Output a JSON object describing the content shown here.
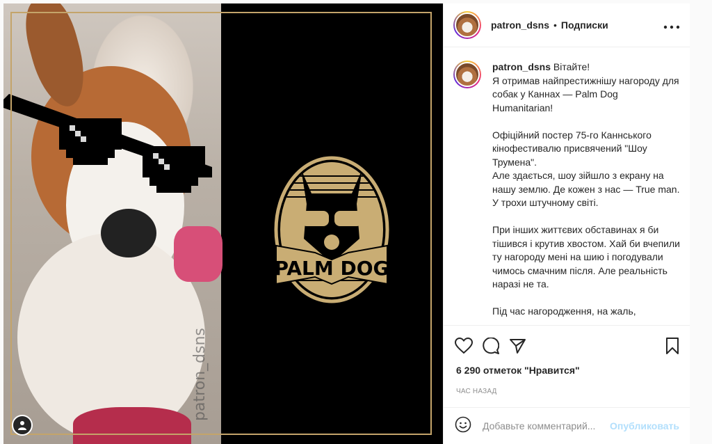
{
  "post": {
    "watermark": "patron_dsns",
    "logo_text": "PALM DOG"
  },
  "header": {
    "username": "patron_dsns",
    "separator": "•",
    "follow_label": "Подписки",
    "more_label": "•••"
  },
  "caption": {
    "username": "patron_dsns",
    "text": "Вітайте!\nЯ отримав найпрестижнішу нагороду для собак у Каннах — Palm Dog Humanitarian!\n\nОфіційний постер 75-го Каннського кінофестивалю присвячений \"Шоу Трумена\".\nАле здається, шоу зійшло з екрану на нашу землю. Де кожен з нас — True man. У трохи штучному світі.\n\nПри інших життєвих обставинах я би тішився і крутив хвостом. Хай би вчепили ту нагороду мені на шию і погодували чимось смачним після. Але реальність наразі не та.\n\nПід час нагородження, на жаль,"
  },
  "actions": {
    "likes": "6 290 отметок \"Нравится\"",
    "time": "ЧАС НАЗАД"
  },
  "comment": {
    "placeholder": "Добавьте комментарий...",
    "post_label": "Опубликовать"
  },
  "colors": {
    "frame_gold": "#c4a46a",
    "logo_gold": "#c9ad74",
    "post_disabled": "#b2dffc"
  }
}
